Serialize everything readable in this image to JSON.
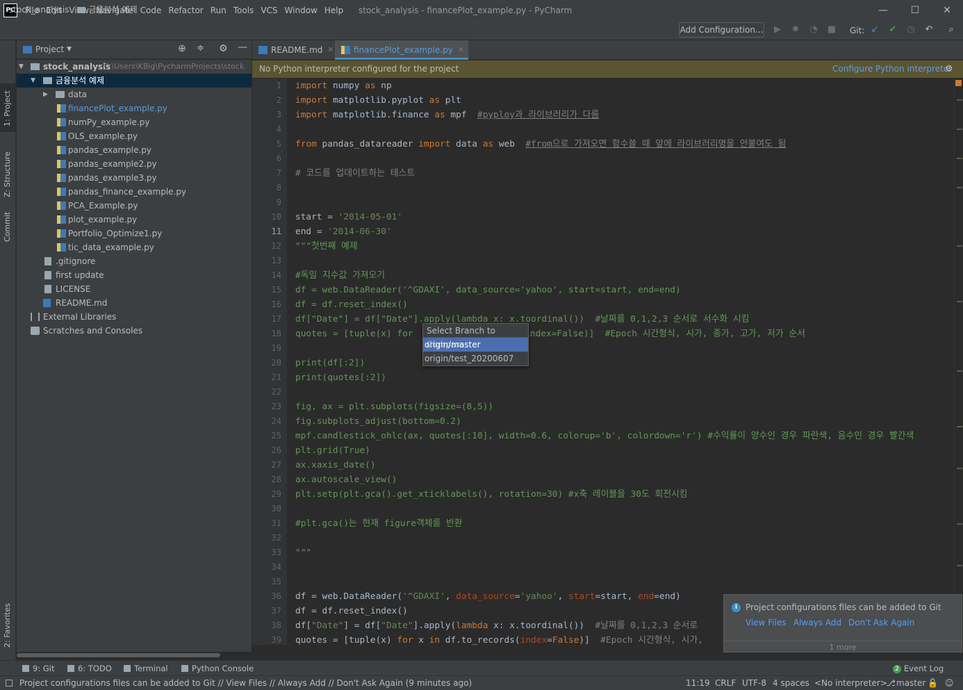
{
  "menu": [
    "File",
    "Edit",
    "View",
    "Navigate",
    "Code",
    "Refactor",
    "Run",
    "Tools",
    "VCS",
    "Window",
    "Help"
  ],
  "window_title": "stock_analysis - financePlot_example.py - PyCharm",
  "window_controls": {
    "minimize": "—",
    "maximize": "☐",
    "close": "✕"
  },
  "breadcrumb": {
    "project": "stock_analysis",
    "folder": "금융분석 예제"
  },
  "toolbar": {
    "add_config": "Add Configuration...",
    "git_label": "Git:"
  },
  "left_strip": {
    "project": "1: Project",
    "structure": "Z: Structure",
    "commit": "Commit",
    "favorites": "2: Favorites"
  },
  "project_panel": {
    "title": "Project"
  },
  "tree": {
    "root_name": "stock_analysis",
    "root_path": "C:\\Users\\KBig\\PycharmProjects\\stock",
    "folder": "금융분석 예제",
    "data": "data",
    "files": [
      "financePlot_example.py",
      "numPy_example.py",
      "OLS_example.py",
      "pandas_example.py",
      "pandas_example2.py",
      "pandas_example3.py",
      "pandas_finance_example.py",
      "PCA_Example.py",
      "plot_example.py",
      "Portfolio_Optimize1.py",
      "tic_data_example.py"
    ],
    "gitignore": ".gitignore",
    "first_update": "first update",
    "license": "LICENSE",
    "readme": "README.md",
    "ext_libs": "External Libraries",
    "scratches": "Scratches and Consoles"
  },
  "editor_tabs": [
    "README.md",
    "financePlot_example.py"
  ],
  "warning": {
    "text": "No Python interpreter configured for the project",
    "link": "Configure Python interpreter"
  },
  "code": {
    "line_numbers": [
      "1",
      "2",
      "3",
      "4",
      "5",
      "6",
      "7",
      "8",
      "9",
      "10",
      "11",
      "12",
      "13",
      "14",
      "15",
      "16",
      "17",
      "18",
      "19",
      "20",
      "21",
      "22",
      "23",
      "24",
      "25",
      "26",
      "27",
      "28",
      "29",
      "30",
      "31",
      "32",
      "33",
      "34",
      "35",
      "36",
      "37",
      "38",
      "39"
    ],
    "current_line": "11",
    "l1_kw": "import",
    "l1_rest": " numpy ",
    "l1_as": "as",
    "l1_end": " np",
    "l2_kw": "import",
    "l2_rest": " matplotlib.pyplot ",
    "l2_as": "as",
    "l2_end": " plt",
    "l3_kw": "import",
    "l3_rest": " matplotlib.finance ",
    "l3_as": "as",
    "l3_end": " mpf  ",
    "l3_cmt": "#pyploy과 라이브러리가 다름",
    "l5_kw": "from",
    "l5_rest": " pandas_datareader ",
    "l5_imp": "import",
    "l5_mid": " data ",
    "l5_as": "as",
    "l5_end": " web  ",
    "l5_cmt": "#from으로 가져오면 함수쓸 때 앞에 라이브러리명을 안붙여도 됨",
    "l7": "# 코드를 업데이트하는 테스트",
    "l10_a": "start = ",
    "l10_s": "'2014-05-01'",
    "l11_a": "end = ",
    "l11_s": "'2014-06-30'",
    "l12": "\"\"\"첫번째 예제",
    "l14": "#독일 지수값 가져오기",
    "l15": "df = web.DataReader('^GDAXI', data_source='yahoo', start=start, end=end)",
    "l16": "df = df.reset_index()",
    "l17": "df[\"Date\"] = df[\"Date\"].apply(lambda x: x.toordinal())  #날짜를 0,1,2,3 순서로 서수화 시킴",
    "l18_a": "quotes = [tuple(x) for ",
    "l18_b": "index=False)]  #Epoch 시간형식, 시가, 종가, 고가, 저가 순서",
    "l20": "print(df[:2])",
    "l21": "print(quotes[:2])",
    "l23": "fig, ax = plt.subplots(figsize=(8,5))",
    "l24": "fig.subplots_adjust(bottom=0.2)",
    "l25": "mpf.candlestick_ohlc(ax, quotes[:10], width=0.6, colorup='b', colordown='r') #수익률이 양수인 경우 파란색, 음수인 경우 빨간색",
    "l26": "plt.grid(True)",
    "l27": "ax.xaxis_date()",
    "l28": "ax.autoscale_view()",
    "l29": "plt.setp(plt.gca().get_xticklabels(), rotation=30) #x축 레이블을 30도 회전시킴",
    "l31": "#plt.gca()는 현재 figure객체를 반환",
    "l33": "\"\"\"",
    "l36_a": "df = web.DataReader(",
    "l36_s1": "'^GDAXI'",
    "l36_b": ", ",
    "l36_p1": "data_source",
    "l36_c": "=",
    "l36_s2": "'yahoo'",
    "l36_d": ", ",
    "l36_p2": "start",
    "l36_e": "=start, ",
    "l36_p3": "end",
    "l36_f": "=end)",
    "l37": "df = df.reset_index()",
    "l38_a": "df[",
    "l38_s1": "\"Date\"",
    "l38_b": "] = df[",
    "l38_s2": "\"Date\"",
    "l38_c": "].apply(",
    "l38_kw": "lambda",
    "l38_d": " x: x.toordinal())  ",
    "l38_cmt": "#날짜를 0,1,2,3 순서로",
    "l39_a": "quotes = [tuple(x) ",
    "l39_for": "for",
    "l39_b": " x ",
    "l39_in": "in",
    "l39_c": " df.to_records(",
    "l39_p": "index",
    "l39_d": "=",
    "l39_f": "False",
    "l39_e": ")]  ",
    "l39_cmt": "#Epoch 시간형식, 시가,"
  },
  "branch_popup": {
    "title": "Select Branch to Compare",
    "options": [
      "origin/master",
      "origin/test_20200607"
    ],
    "selected": "origin/master"
  },
  "notification": {
    "message": "Project configurations files can be added to Git",
    "actions": [
      "View Files",
      "Always Add",
      "Don't Ask Again"
    ],
    "more": "1 more"
  },
  "bottom_tabs": [
    "9: Git",
    "6: TODO",
    "Terminal",
    "Python Console"
  ],
  "event_log": {
    "count": "2",
    "label": "Event Log"
  },
  "status": {
    "message": "Project configurations files can be added to Git // View Files // Always Add // Don't Ask Again (9 minutes ago)",
    "position": "11:19",
    "line_sep": "CRLF",
    "encoding": "UTF-8",
    "indent": "4 spaces",
    "interpreter": "<No interpreter>",
    "branch": "master"
  },
  "colors": {
    "accent": "#4a88c7",
    "keyword": "#cc7832",
    "string": "#6a8759",
    "comment": "#808080",
    "param": "#aa4926",
    "link": "#589df6"
  }
}
